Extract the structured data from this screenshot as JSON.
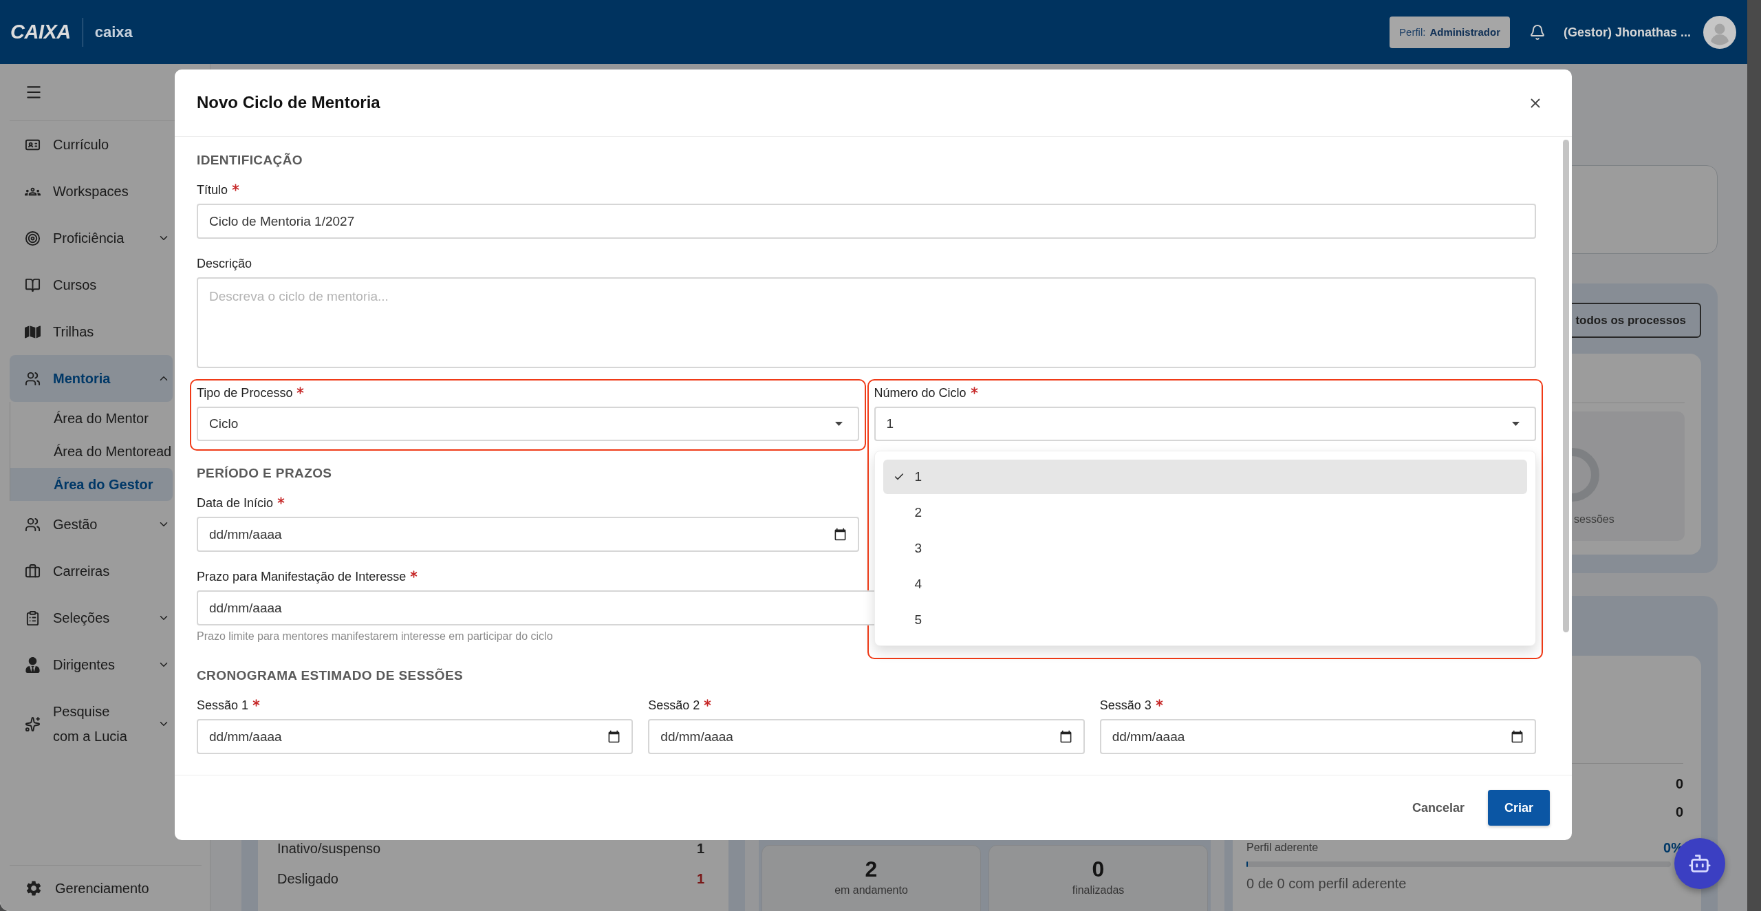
{
  "header": {
    "logo": "CAIXA",
    "app_name": "caixa",
    "profile": {
      "label": "Perfil:",
      "value": "Administrador"
    },
    "user_name": "(Gestor) Jhonathas ..."
  },
  "sidebar": {
    "items": [
      {
        "label": "Currículo",
        "selected": false
      },
      {
        "label": "Workspaces",
        "selected": false
      },
      {
        "label": "Proficiência",
        "selected": false,
        "expanded": false
      },
      {
        "label": "Cursos",
        "selected": false
      },
      {
        "label": "Trilhas",
        "selected": false
      },
      {
        "label": "Mentoria",
        "selected": true,
        "expanded": true,
        "children": [
          {
            "label": "Área do Mentor",
            "selected": false
          },
          {
            "label": "Área do Mentoread",
            "selected": false
          },
          {
            "label": "Área do Gestor",
            "selected": true
          }
        ]
      },
      {
        "label": "Gestão",
        "selected": false,
        "expanded": false
      },
      {
        "label": "Carreiras",
        "selected": false
      },
      {
        "label": "Seleções",
        "selected": false,
        "expanded": false
      },
      {
        "label": "Dirigentes",
        "selected": false,
        "expanded": false
      },
      {
        "label": "Pesquise com a Lucia",
        "selected": false,
        "expanded": false
      }
    ],
    "footer_item": {
      "label": "Gerenciamento"
    }
  },
  "dashboard": {
    "processes_button": "todos os processos",
    "sessions_caption": "sessões",
    "status_rows": [
      {
        "label": "Inativo/suspenso",
        "value": "1",
        "alert": false
      },
      {
        "label": "Desligado",
        "value": "1",
        "alert": true
      }
    ],
    "stat_cards": [
      {
        "value": "2",
        "caption": "em andamento"
      },
      {
        "value": "0",
        "caption": "finalizadas"
      }
    ],
    "profile_card": {
      "values": [
        "0",
        "0"
      ],
      "label": "Perfil aderente",
      "percent": "0%",
      "level": 0,
      "summary": "0 de 0 com perfil aderente"
    }
  },
  "modal": {
    "title": "Novo Ciclo de Mentoria",
    "sections": [
      {
        "title": "IDENTIFICAÇÃO",
        "rows": [
          {
            "fields": [
              {
                "kind": "text",
                "label": "Título",
                "required": true,
                "value": "Ciclo de Mentoria 1/2027"
              }
            ]
          },
          {
            "fields": [
              {
                "kind": "textarea",
                "label": "Descrição",
                "required": false,
                "placeholder": "Descreva o ciclo de mentoria..."
              }
            ]
          },
          {
            "fields": [
              {
                "kind": "select",
                "label": "Tipo de Processo",
                "required": true,
                "value": "Ciclo",
                "highlighted": true
              },
              {
                "kind": "select",
                "label": "Número do Ciclo",
                "required": true,
                "value": "1",
                "highlighted": true,
                "expanded": true,
                "options": [
                  {
                    "label": "1",
                    "selected": true
                  },
                  {
                    "label": "2",
                    "selected": false
                  },
                  {
                    "label": "3",
                    "selected": false
                  },
                  {
                    "label": "4",
                    "selected": false
                  },
                  {
                    "label": "5",
                    "selected": false
                  }
                ]
              }
            ]
          }
        ]
      },
      {
        "title": "PERÍODO E PRAZOS",
        "rows": [
          {
            "fields": [
              {
                "kind": "date",
                "label": "Data de Início",
                "required": true,
                "placeholder": "dd/mm/aaaa"
              }
            ]
          },
          {
            "fields": [
              {
                "kind": "date",
                "label": "Prazo para Manifestação de Interesse",
                "required": true,
                "placeholder": "dd/mm/aaaa",
                "hint": "Prazo limite para mentores manifestarem interesse em participar do ciclo"
              }
            ]
          }
        ]
      },
      {
        "title": "CRONOGRAMA ESTIMADO DE SESSÕES",
        "rows": [
          {
            "fields": [
              {
                "kind": "date",
                "label": "Sessão 1",
                "required": true,
                "placeholder": "dd/mm/aaaa"
              },
              {
                "kind": "date",
                "label": "Sessão 2",
                "required": true,
                "placeholder": "dd/mm/aaaa"
              },
              {
                "kind": "date",
                "label": "Sessão 3",
                "required": true,
                "placeholder": "dd/mm/aaaa"
              }
            ]
          }
        ]
      }
    ],
    "buttons": [
      {
        "label": "Cancelar",
        "kind": "secondary"
      },
      {
        "label": "Criar",
        "kind": "primary"
      }
    ]
  }
}
